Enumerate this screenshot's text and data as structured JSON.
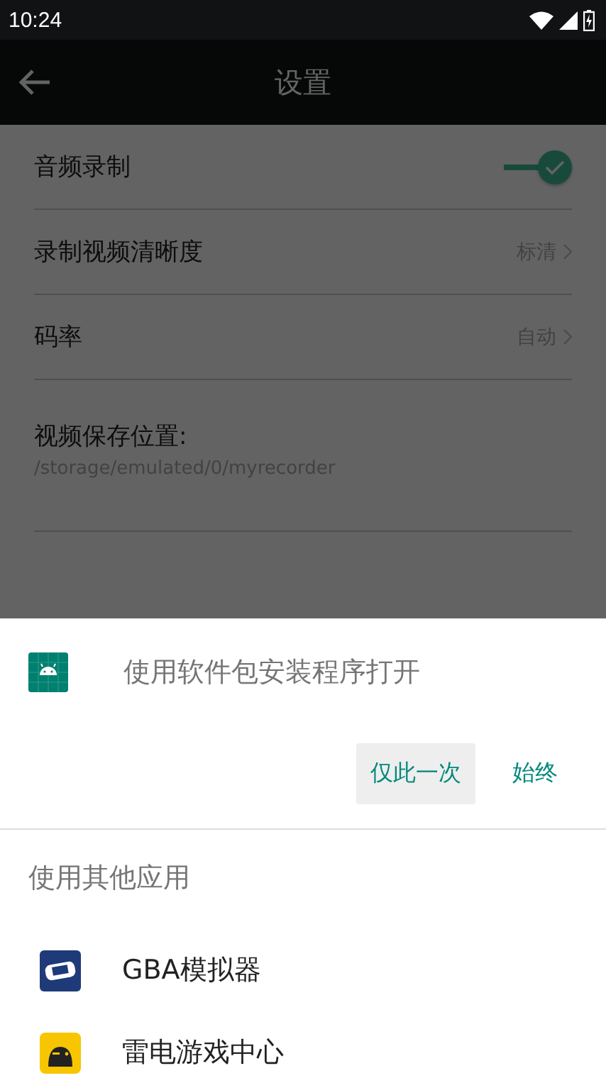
{
  "status_bar": {
    "time": "10:24"
  },
  "app_bar": {
    "title": "设置"
  },
  "settings": [
    {
      "kind": "toggle",
      "label": "音频录制",
      "on": true
    },
    {
      "kind": "choice",
      "label": "录制视频清晰度",
      "value": "标清"
    },
    {
      "kind": "choice",
      "label": "码率",
      "value": "自动"
    },
    {
      "kind": "path",
      "label": "视频保存位置:",
      "value": "/storage/emulated/0/myrecorder"
    }
  ],
  "sheet": {
    "title": "使用软件包安装程序打开",
    "buttons": [
      {
        "label": "仅此一次",
        "selected": true
      },
      {
        "label": "始终",
        "selected": false
      }
    ],
    "section": "使用其他应用",
    "apps": [
      {
        "name": "GBA模拟器",
        "kind": "console"
      },
      {
        "name": "雷电游戏中心",
        "kind": "gamepad"
      }
    ]
  }
}
